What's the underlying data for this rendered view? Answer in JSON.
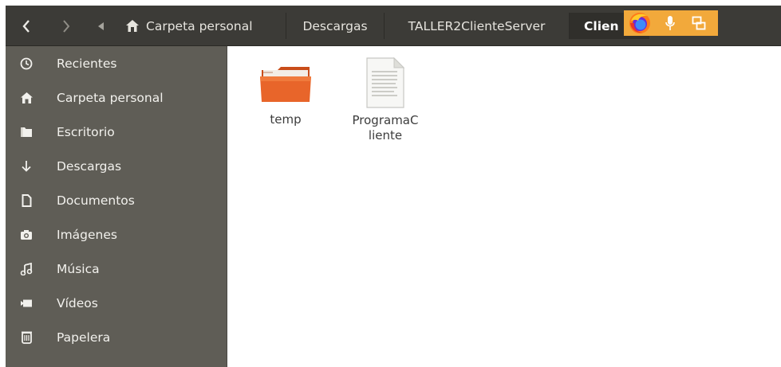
{
  "header": {
    "breadcrumbs": [
      {
        "label": "Carpeta personal",
        "icon": "home-icon"
      },
      {
        "label": "Descargas"
      },
      {
        "label": "TALLER2ClienteServer"
      },
      {
        "label": "Clien"
      }
    ],
    "tray_icons": [
      "firefox-icon",
      "microphone-icon",
      "window-switch-icon"
    ]
  },
  "sidebar": {
    "items": [
      {
        "label": "Recientes",
        "icon": "clock-icon"
      },
      {
        "label": "Carpeta personal",
        "icon": "home-icon"
      },
      {
        "label": "Escritorio",
        "icon": "folder-icon"
      },
      {
        "label": "Descargas",
        "icon": "download-icon"
      },
      {
        "label": "Documentos",
        "icon": "document-icon"
      },
      {
        "label": "Imágenes",
        "icon": "camera-icon"
      },
      {
        "label": "Música",
        "icon": "music-icon"
      },
      {
        "label": "Vídeos",
        "icon": "video-icon"
      },
      {
        "label": "Papelera",
        "icon": "trash-icon"
      }
    ]
  },
  "files": [
    {
      "name": "temp",
      "type": "folder"
    },
    {
      "name_line1": "ProgramaC",
      "name_line2": "liente",
      "type": "text-file"
    }
  ],
  "colors": {
    "header_bg": "#3c3b37",
    "sidebar_bg": "#5f5d56",
    "folder_orange": "#e8652a",
    "tray_bg": "#f2a93b"
  }
}
